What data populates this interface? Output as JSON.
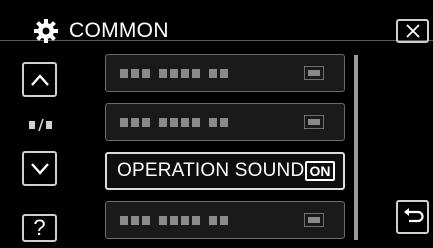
{
  "header": {
    "title": "COMMON",
    "title_icon": "gear-icon",
    "close_icon": "close-icon"
  },
  "nav": {
    "up_icon": "chevron-up-icon",
    "down_icon": "chevron-down-icon",
    "page_indicator_icon": "page-indicator-icon",
    "help_label": "?",
    "back_icon": "return-icon"
  },
  "menu": {
    "items": [
      {
        "label": "",
        "value": "",
        "state": "dim"
      },
      {
        "label": "",
        "value": "",
        "state": "dim"
      },
      {
        "label": "OPERATION SOUND",
        "value": "ON",
        "state": "active"
      },
      {
        "label": "",
        "value": "",
        "state": "dim"
      }
    ]
  },
  "colors": {
    "background": "#000000",
    "text": "#ffffff",
    "border": "#d0d0d0",
    "placeholder": "#8a8a8a"
  }
}
